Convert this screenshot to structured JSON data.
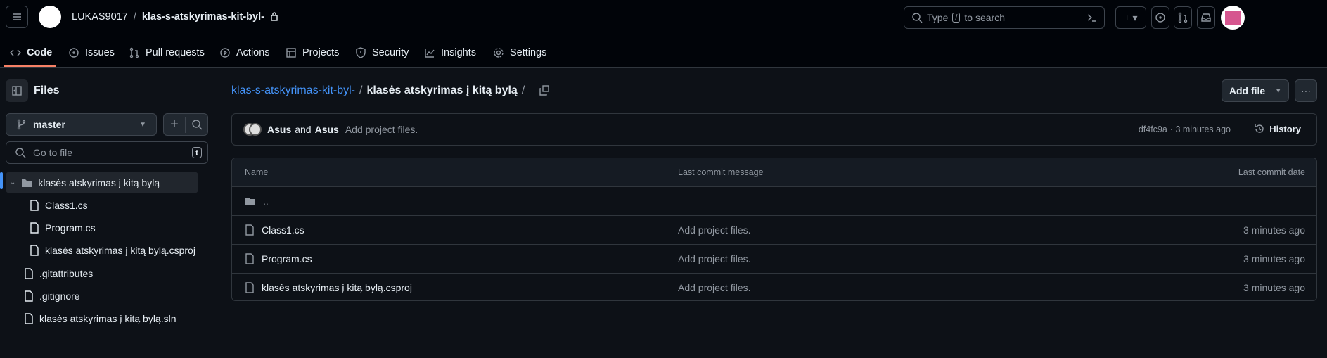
{
  "header": {
    "owner": "LUKAS9017",
    "separator": "/",
    "repo": "klas-s-atskyrimas-kit-byl-",
    "search_placeholder_pre": "Type",
    "search_key": "/",
    "search_placeholder_post": "to search"
  },
  "nav": [
    {
      "label": "Code",
      "icon": "code-icon"
    },
    {
      "label": "Issues",
      "icon": "issue-icon"
    },
    {
      "label": "Pull requests",
      "icon": "pull-request-icon"
    },
    {
      "label": "Actions",
      "icon": "play-icon"
    },
    {
      "label": "Projects",
      "icon": "table-icon"
    },
    {
      "label": "Security",
      "icon": "shield-icon"
    },
    {
      "label": "Insights",
      "icon": "graph-icon"
    },
    {
      "label": "Settings",
      "icon": "gear-icon"
    }
  ],
  "sidebar": {
    "title": "Files",
    "branch": "master",
    "goto_placeholder": "Go to file",
    "goto_key": "t",
    "tree": [
      {
        "name": "klasės atskyrimas į kitą bylą",
        "type": "folder",
        "level": 0
      },
      {
        "name": "Class1.cs",
        "type": "file",
        "level": 1
      },
      {
        "name": "Program.cs",
        "type": "file",
        "level": 1
      },
      {
        "name": "klasės atskyrimas į kitą bylą.csproj",
        "type": "file",
        "level": 1
      },
      {
        "name": ".gitattributes",
        "type": "file",
        "level": 0
      },
      {
        "name": ".gitignore",
        "type": "file",
        "level": 0
      },
      {
        "name": "klasės atskyrimas į kitą bylą.sln",
        "type": "file",
        "level": 0
      }
    ]
  },
  "breadcrumb": {
    "repo": "klas-s-atskyrimas-kit-byl-",
    "sep": "/",
    "folder": "klasės atskyrimas į kitą bylą",
    "trail": "/"
  },
  "actions": {
    "add_file": "Add file"
  },
  "commit": {
    "author1": "Asus",
    "and": "and",
    "author2": "Asus",
    "message": "Add project files.",
    "sha": "df4fc9a",
    "time": "· 3 minutes ago",
    "history": "History"
  },
  "table": {
    "headers": [
      "Name",
      "Last commit message",
      "Last commit date"
    ],
    "parent": "..",
    "rows": [
      {
        "name": "Class1.cs",
        "message": "Add project files.",
        "date": "3 minutes ago"
      },
      {
        "name": "Program.cs",
        "message": "Add project files.",
        "date": "3 minutes ago"
      },
      {
        "name": "klasės atskyrimas į kitą bylą.csproj",
        "message": "Add project files.",
        "date": "3 minutes ago"
      }
    ]
  },
  "colors": {
    "accent": "#4493f8",
    "tab_underline": "#f78166"
  }
}
